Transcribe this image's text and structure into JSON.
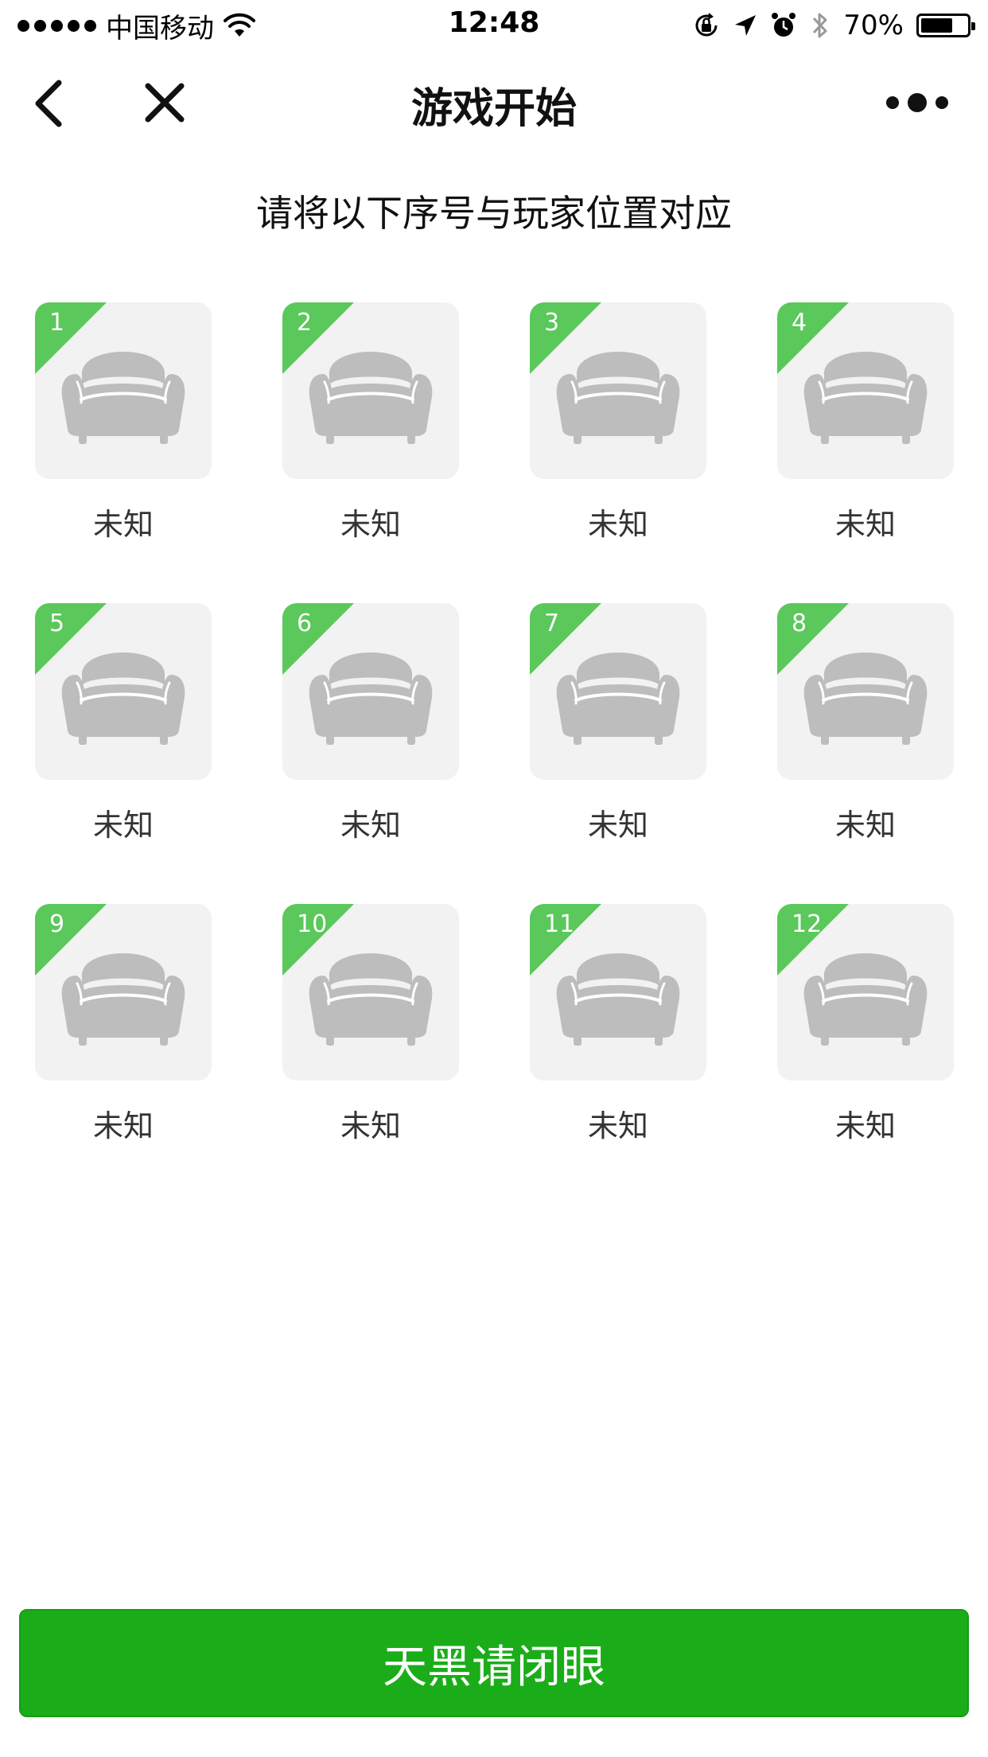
{
  "status_bar": {
    "carrier": "中国移动",
    "time": "12:48",
    "battery_percent": "70%",
    "battery_level": 0.7,
    "icons": [
      "signal-dots-icon",
      "wifi-icon",
      "orientation-lock-icon",
      "location-icon",
      "alarm-icon",
      "bluetooth-icon",
      "battery-icon"
    ]
  },
  "nav": {
    "title": "游戏开始",
    "icons": [
      "back-arrow-icon",
      "close-icon",
      "more-dots-icon"
    ]
  },
  "subtitle": "请将以下序号与玩家位置对应",
  "seats": [
    {
      "number": "1",
      "label": "未知"
    },
    {
      "number": "2",
      "label": "未知"
    },
    {
      "number": "3",
      "label": "未知"
    },
    {
      "number": "4",
      "label": "未知"
    },
    {
      "number": "5",
      "label": "未知"
    },
    {
      "number": "6",
      "label": "未知"
    },
    {
      "number": "7",
      "label": "未知"
    },
    {
      "number": "8",
      "label": "未知"
    },
    {
      "number": "9",
      "label": "未知"
    },
    {
      "number": "10",
      "label": "未知"
    },
    {
      "number": "11",
      "label": "未知"
    },
    {
      "number": "12",
      "label": "未知"
    }
  ],
  "seat_icon": "sofa-icon",
  "action_button": {
    "label": "天黑请闭眼"
  },
  "colors": {
    "accent_green": "#1aad19",
    "corner_green": "#5ac85a",
    "card_bg": "#f2f2f2",
    "sofa_gray": "#bdbdbd"
  }
}
